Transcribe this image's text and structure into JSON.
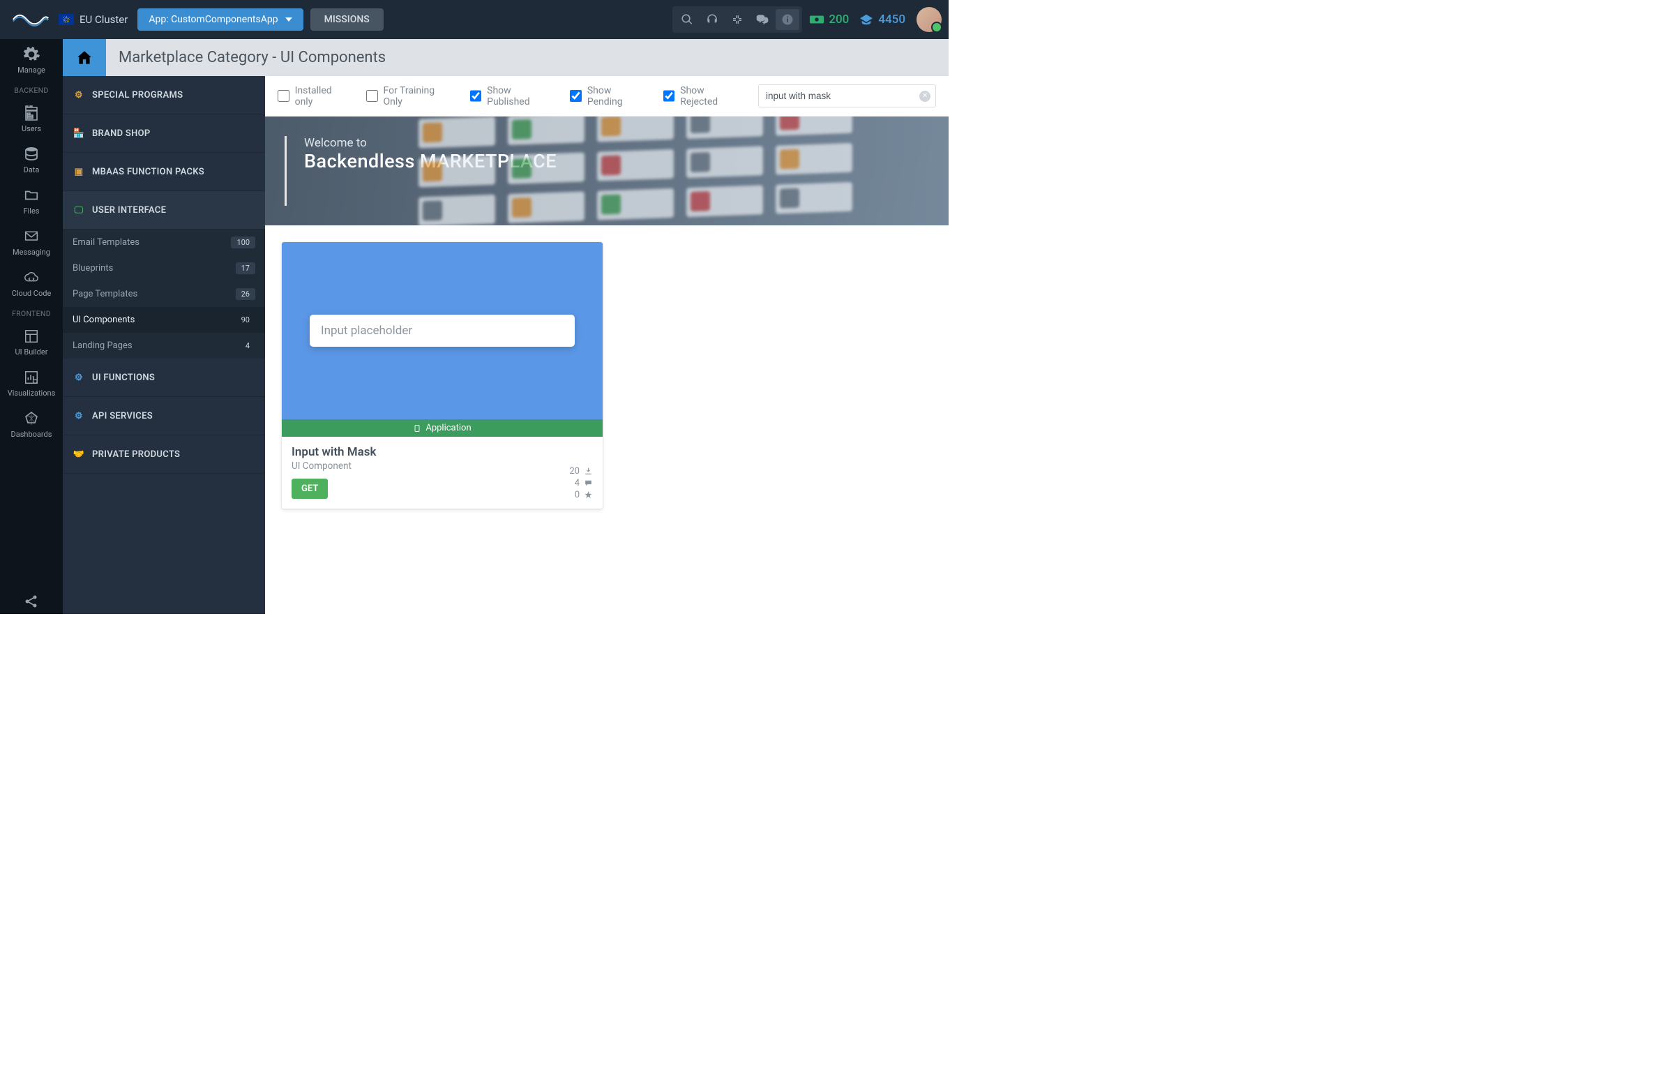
{
  "header": {
    "cluster": "EU Cluster",
    "app_dropdown": "App: CustomComponentsApp",
    "missions": "MISSIONS",
    "credits_cash": "200",
    "credits_points": "4450"
  },
  "nav": {
    "sections": {
      "backend": "BACKEND",
      "frontend": "FRONTEND"
    },
    "items": {
      "manage": "Manage",
      "users": "Users",
      "data": "Data",
      "files": "Files",
      "messaging": "Messaging",
      "cloudcode": "Cloud Code",
      "uibuilder": "UI Builder",
      "visualizations": "Visualizations",
      "dashboards": "Dashboards"
    }
  },
  "sidebar": {
    "page_title": "Marketplace Category - UI Components",
    "special": "SPECIAL PROGRAMS",
    "brand": "BRAND SHOP",
    "mbaas": "MBAAS FUNCTION PACKS",
    "ui": "USER INTERFACE",
    "ui_sub": {
      "email": {
        "label": "Email Templates",
        "count": "100"
      },
      "blueprints": {
        "label": "Blueprints",
        "count": "17"
      },
      "pagetpl": {
        "label": "Page Templates",
        "count": "26"
      },
      "uicomp": {
        "label": "UI Components",
        "count": "90"
      },
      "landing": {
        "label": "Landing Pages",
        "count": "4"
      }
    },
    "uifn": "UI FUNCTIONS",
    "apisvc": "API SERVICES",
    "private": "PRIVATE PRODUCTS"
  },
  "filters": {
    "installed": "Installed only",
    "training": "For Training Only",
    "published": "Show Published",
    "pending": "Show Pending",
    "rejected": "Show Rejected",
    "search_value": "input with mask"
  },
  "hero": {
    "line1": "Welcome to",
    "line2": "Backendless MARKETPLACE"
  },
  "card": {
    "placeholder": "Input placeholder",
    "ribbon": "Application",
    "title": "Input with Mask",
    "subtitle": "UI Component",
    "get": "GET",
    "downloads": "20",
    "comments": "4",
    "stars": "0"
  }
}
